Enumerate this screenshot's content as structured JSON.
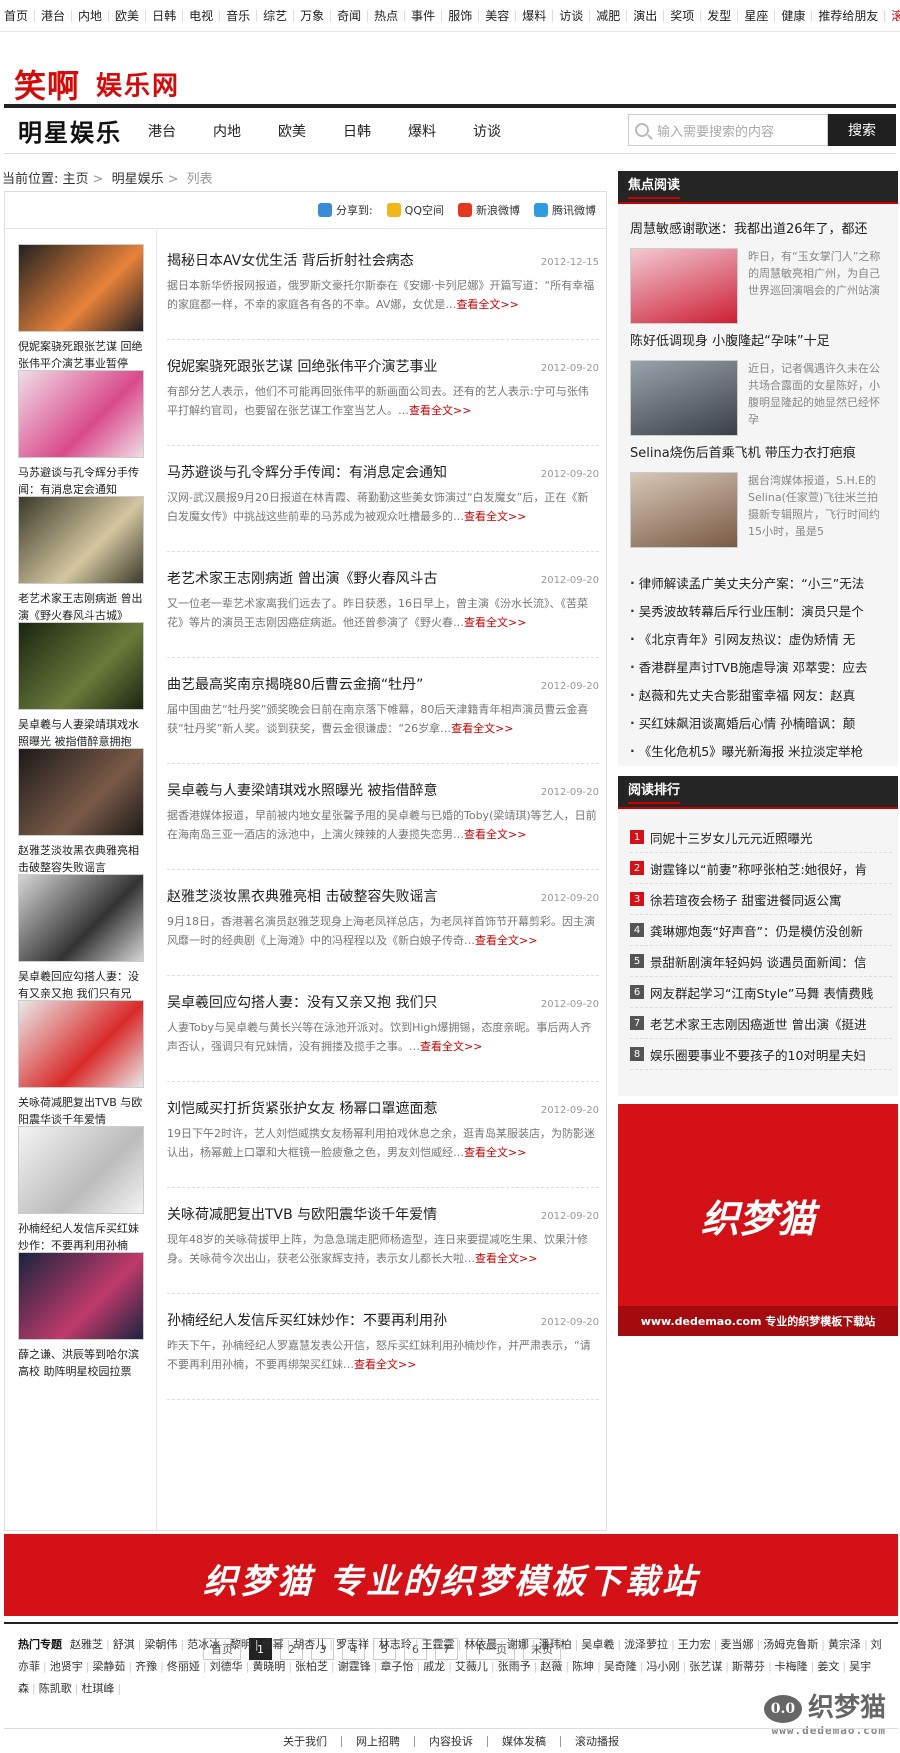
{
  "topnav": [
    "首页",
    "港台",
    "内地",
    "欧美",
    "日韩",
    "电视",
    "音乐",
    "综艺",
    "万象",
    "奇闻",
    "热点",
    "事件",
    "服饰",
    "美容",
    "爆料",
    "访谈",
    "减肥",
    "演出",
    "奖项",
    "发型",
    "星座",
    "健康",
    "推荐给朋友",
    "滚动播报"
  ],
  "logo": {
    "part1": "笑啊",
    "part2": "娱乐网"
  },
  "channel": {
    "title": "明星娱乐",
    "items": [
      "港台",
      "内地",
      "欧美",
      "日韩",
      "爆料",
      "访谈"
    ],
    "search_placeholder": "输入需要搜索的内容",
    "search_button": "搜索"
  },
  "breadcrumb": {
    "label": "当前位置:",
    "home": "主页",
    "section": "明星娱乐",
    "current": "列表"
  },
  "share": {
    "label": "分享到:",
    "items": [
      "QQ空间",
      "新浪微博",
      "腾讯微博"
    ]
  },
  "left_cards": [
    {
      "cap": "倪妮案骁死跟张艺谋 回绝张伟平介演艺事业暂停"
    },
    {
      "cap": "马苏避谈与孔令辉分手传闻：有消息定会通知"
    },
    {
      "cap": "老艺术家王志刚病逝 曾出演《野火春风斗古城》"
    },
    {
      "cap": "吴卓羲与人妻梁靖琪戏水照曝光 被指借醉意拥抱"
    },
    {
      "cap": "赵雅芝淡妆黑衣典雅亮相 击破整容失败谣言"
    },
    {
      "cap": "吴卓羲回应勾搭人妻：没有又亲又抱 我们只有兄"
    },
    {
      "cap": "关咏荷减肥复出TVB 与欧阳震华谈千年爱情"
    },
    {
      "cap": "孙楠经纪人发信斥买红妹炒作：不要再利用孙楠"
    },
    {
      "cap": "薛之谦、洪辰等到哈尔滨高校 助阵明星校园拉票"
    }
  ],
  "articles": [
    {
      "title": "揭秘日本AV女优生活 背后折射社会病态",
      "date": "2012-12-15",
      "summary": "据日本新华侨报网报道，俄罗斯文豪托尔斯泰在《安娜·卡列尼娜》开篇写道：“所有幸福的家庭都一样，不幸的家庭各有各的不幸。AV娜，女优是",
      "more": "查看全文>>"
    },
    {
      "title": "倪妮案骁死跟张艺谋 回绝张伟平介演艺事业",
      "date": "2012-09-20",
      "summary": "有部分艺人表示，他们不可能再回张伟平的新画面公司去。还有的艺人表示:宁可与张伟平打解约官司，也要留在张艺谋工作室当艺人。",
      "more": "查看全文>>"
    },
    {
      "title": "马苏避谈与孔令辉分手传闻：有消息定会通知",
      "date": "2012-09-20",
      "summary": "汉网-武汉晨报9月20日报道在林青霞、蒋勤勤这些美女饰演过“白发魔女”后，正在《新白发魔女传》中挑战这些前辈的马苏成为被观众吐槽最多的",
      "more": "查看全文>>"
    },
    {
      "title": "老艺术家王志刚病逝 曾出演《野火春风斗古",
      "date": "2012-09-20",
      "summary": "又一位老一辈艺术家离我们远去了。昨日获悉，16日早上，曾主演《汾水长流》、《苦菜花》等片的演员王志刚因癌症病逝。他还曾参演了《野火春",
      "more": "查看全文>>"
    },
    {
      "title": "曲艺最高奖南京揭晓80后曹云金摘“牡丹”",
      "date": "2012-09-20",
      "summary": "届中国曲艺“牡丹奖”颁奖晚会日前在南京落下帷幕，80后天津籍青年相声演员曹云金喜获“牡丹奖”新人奖。谈到获奖，曹云金很谦虚：“26岁拿",
      "more": "查看全文>>"
    },
    {
      "title": "吴卓羲与人妻梁靖琪戏水照曝光 被指借醉意",
      "date": "2012-09-20",
      "summary": "据香港媒体报道，早前被内地女星张馨予甩的吴卓羲与已婚的Toby(梁靖琪)等艺人，日前在海南岛三亚一酒店的泳池中，上演火辣辣的人妻揽失恋男",
      "more": "查看全文>>"
    },
    {
      "title": "赵雅芝淡妆黑衣典雅亮相 击破整容失败谣言",
      "date": "2012-09-20",
      "summary": "9月18日，香港著名演员赵雅芝现身上海老凤祥总店，为老凤祥首饰节开幕剪彩。因主演风靡一时的经典剧《上海滩》中的冯程程以及《新白娘子传奇",
      "more": "查看全文>>"
    },
    {
      "title": "吴卓羲回应勾搭人妻：没有又亲又抱 我们只",
      "date": "2012-09-20",
      "summary": "人妻Toby与吴卓羲与黄长兴等在泳池开派对。饮到High爆拥锡，态度亲昵。事后两人齐声否认，强调只有兄妹情，没有拥搂及揽手之事。",
      "more": "查看全文>>"
    },
    {
      "title": "刘恺威买打折货紧张护女友 杨幂口罩遮面惹",
      "date": "2012-09-20",
      "summary": "19日下午2时许，艺人刘恺威携女友杨幂利用拍戏休息之余，逛青岛某服装店，为防影迷认出，杨幂戴上口罩和大框镜一脸疲惫之色，男友刘恺威经",
      "more": "查看全文>>"
    },
    {
      "title": "关咏荷减肥复出TVB 与欧阳震华谈千年爱情",
      "date": "2012-09-20",
      "summary": "现年48岁的关咏荷拔甲上阵，为急急瑞走肥师杨造型，连日来要提减吃生果、饮果汁修身。关咏荷今次出山，获老公张家辉支持，表示女儿都长大啦",
      "more": "查看全文>>"
    },
    {
      "title": "孙楠经纪人发信斥买红妹炒作：不要再利用孙",
      "date": "2012-09-20",
      "summary": "昨天下午，孙楠经纪人罗嘉慧发表公开信，怒斥买红妹利用孙楠炒作，并严肃表示，“请不要再利用孙楠，不要再绑架买红妹",
      "more": "查看全文>>"
    }
  ],
  "pager": [
    "首页",
    "1",
    "2",
    "3",
    "4",
    "5",
    "6",
    "7",
    "下一页",
    "末页"
  ],
  "focus": {
    "title": "焦点阅读",
    "features": [
      {
        "title": "周慧敏感谢歌迷：我都出道26年了，都还",
        "summary": "昨日，有“玉女掌门人”之称的周慧敏亮相广州，为自己世界巡回演唱会的广州站演"
      },
      {
        "title": "陈好低调现身 小腹隆起“孕味”十足",
        "summary": "近日，记者偶遇许久未在公共场合露面的女星陈好，小腹明显隆起的她显然已经怀孕"
      },
      {
        "title": "Selina烧伤后首乘飞机 带压力衣打疤痕",
        "summary": "据台湾媒体报道，S.H.E的Selina(任家萱)飞往米兰拍摄新专辑照片，飞行时间约15小时，虽是5"
      }
    ],
    "list": [
      "律师解读孟广美丈夫分产案：“小三”无法",
      "吴秀波故转幕后斥行业压制：演员只是个",
      "《北京青年》引网友热议：虚伪矫情 无",
      "香港群星声讨TVB施虐导演 邓萃雯：应去",
      "赵薇和先丈夫合影甜蜜幸福 网友：赵真",
      "买红妹飙泪谈离婚后心情 孙楠暗讽：颠",
      "《生化危机5》曝光新海报 米拉淡定举枪"
    ]
  },
  "rank": {
    "title": "阅读排行",
    "items": [
      "同妮十三岁女儿元元近照曝光",
      "谢霆锋以“前妻”称呼张柏芝:她很好，肯",
      "徐若瑄夜会杨子 甜蜜进餐同返公寓",
      "龚琳娜炮轰“好声音”：仍是模仿没创新",
      "景甜新剧演年轻妈妈 谈遇员面新闻：信",
      "网友群起学习“江南Style”马舞 表情费贱",
      "老艺术家王志刚因癌逝世 曾出演《挺进",
      "娱乐圈要事业不要孩子的10对明星夫妇"
    ]
  },
  "right_ad": {
    "big": "织梦猫",
    "foot": "www.dedemao.com 专业的织梦模板下载站"
  },
  "banner": {
    "text": "织梦猫 专业的织梦模板下载站"
  },
  "hot": {
    "label": "热门专题",
    "tags": [
      "赵雅芝",
      "舒淇",
      "梁朝伟",
      "范冰冰",
      "黎明",
      "杨幂",
      "胡杏儿",
      "罗志祥",
      "林志玲",
      "王霆霆",
      "林依晨",
      "谢娜",
      "潘玮柏",
      "吴卓羲",
      "泷泽萝拉",
      "王力宏",
      "麦当娜",
      "汤姆克鲁斯",
      "黄宗泽",
      "刘亦菲",
      "池贤宇",
      "梁静茹",
      "齐豫",
      "佟丽娅",
      "刘德华",
      "黄晓明",
      "张柏芝",
      "谢霆锋",
      "章子怡",
      "戚龙",
      "艾薇儿",
      "张雨予",
      "赵薇",
      "陈坤",
      "吴奇隆",
      "冯小刚",
      "张艺谋",
      "斯蒂芬",
      "卡梅隆",
      "姜文",
      "吴宇森",
      "陈凯歌",
      "杜琪峰"
    ]
  },
  "footer": [
    "关于我们",
    "网上招聘",
    "内容投诉",
    "媒体发稿",
    "滚动播报"
  ],
  "watermark": {
    "icon": "0.0",
    "text": "织梦猫",
    "url": "www.dedemao.com"
  },
  "colors": {
    "accent": "#d41116",
    "dark": "#252525",
    "more_link": "#cc0000"
  }
}
